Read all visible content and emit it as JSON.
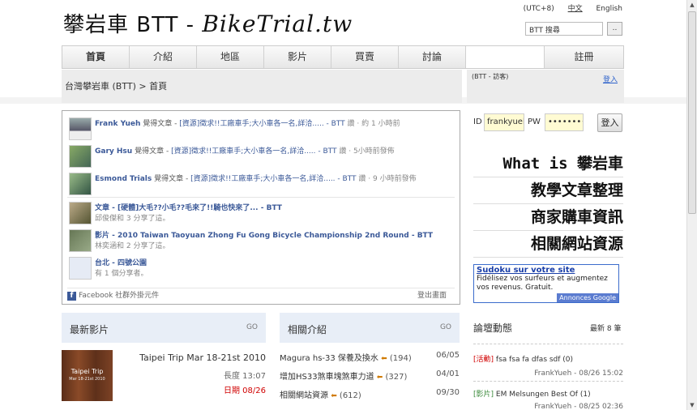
{
  "header": {
    "logo_main": "攀岩車 BTT - ",
    "logo_script": "BikeTrial.tw",
    "timezone": "(UTC+8)",
    "lang_zh": "中文",
    "lang_en": "English",
    "search_value": "BTT 搜尋",
    "search_button": ".."
  },
  "nav": {
    "items": [
      "首頁",
      "介紹",
      "地區",
      "影片",
      "買賣",
      "討論"
    ],
    "register": "註冊"
  },
  "breadcrumb": "台灣攀岩車 (BTT) > 首頁",
  "userbox": {
    "guest": "(BTT - 訪客)",
    "login_link": "登入"
  },
  "activity": [
    {
      "name": "Frank Yueh",
      "verb": "覺得文章 - ",
      "link": "[資源]徵求!!工廠車手;大小車各一名,詳洽..... - BTT",
      "meta": "讚 · 約 1 小時前"
    },
    {
      "name": "Gary Hsu",
      "verb": "覺得文章 - ",
      "link": "[資源]徵求!!工廠車手;大小車各一名,詳洽..... - BTT",
      "meta": "讚 · 5小時前發佈"
    },
    {
      "name": "Esmond Trials",
      "verb": "覺得文章 - ",
      "link": "[資源]徵求!!工廠車手;大小車各一名,詳洽..... - BTT",
      "meta": "讚 · 9 小時前發佈"
    }
  ],
  "shares": [
    {
      "title": "文章 - [硬體]大毛??小毛??毛來了!!騎也快來了... - BTT",
      "sub": "邱俊傑和 3 分享了這。"
    },
    {
      "title": "影片 - 2010 Taiwan Taoyuan Zhong Fu Gong Bicycle Championship 2nd Round - BTT",
      "sub": "林奕涵和 2 分享了這。"
    },
    {
      "title": "台北 - 四號公園",
      "sub": "有 1 個分享者。"
    }
  ],
  "fb_footer": {
    "plugin": "Facebook 社群外掛元件",
    "logout": "登出畫面"
  },
  "login": {
    "id_label": "ID",
    "id_value": "frankyueh",
    "pw_label": "PW",
    "pw_value": "••••••••",
    "button": "登入"
  },
  "big_links": [
    "What is 攀岩車",
    "教學文章整理",
    "商家購車資訊",
    "相關網站資源"
  ],
  "ad": {
    "title": "Sudoku sur votre site",
    "desc": "Fidélisez vos surfeurs et augmentez vos revenus. Gratuit.",
    "badge": "Annonces Google"
  },
  "videos": {
    "heading": "最新影片",
    "go": "GO",
    "item": {
      "thumb_title": "Taipei Trip",
      "thumb_sub": "Mar 18-21st 2010",
      "title": "Taipei Trip Mar 18-21st 2010",
      "length": "長度 13:07",
      "date": "日期 08/26"
    }
  },
  "related": {
    "heading": "相關介紹",
    "go": "GO",
    "items": [
      {
        "title": "Magura hs-33 保養及換水",
        "count": "(194)",
        "date": "06/05"
      },
      {
        "title": "增加HS33煞車塊煞車力道",
        "count": "(327)",
        "date": "04/01"
      },
      {
        "title": "相關網站資源",
        "count": "(612)",
        "date": "09/30"
      }
    ]
  },
  "forum": {
    "heading": "論壇動態",
    "count": "最新 8 筆",
    "posts": [
      {
        "tag": "[活動]",
        "title": "fsa fsa fa dfas sdf (0)",
        "meta": "FrankYueh - 08/26 15:02"
      },
      {
        "tag": "[影片]",
        "title": "EM Melsungen Best Of (1)",
        "meta": "FrankYueh - 08/25 02:36"
      }
    ]
  },
  "colors": {
    "accent": "#3b5998",
    "alert": "#d00000",
    "panel": "#e8eef7"
  }
}
